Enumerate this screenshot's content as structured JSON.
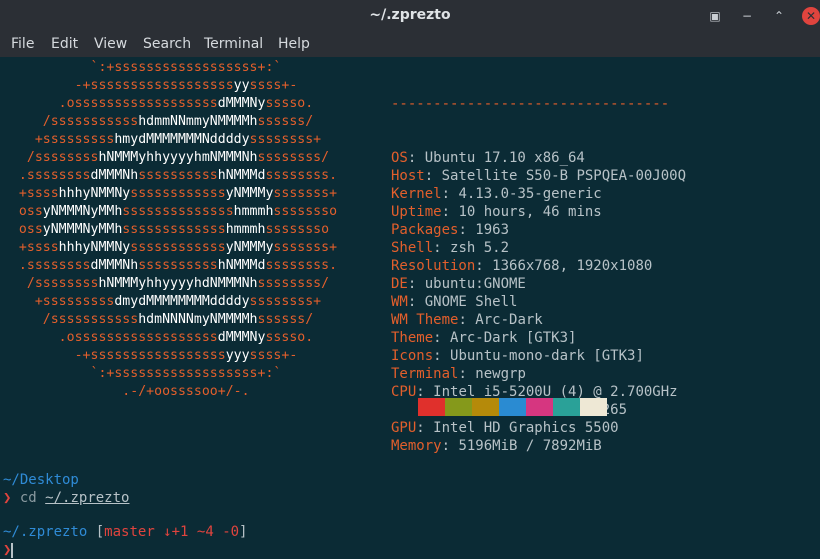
{
  "window": {
    "title": "~/.zprezto",
    "buttons": {
      "terminal_icon": "▣",
      "minimize": "−",
      "restore": "⌃",
      "close": "✕"
    }
  },
  "menu": [
    "File",
    "Edit",
    "View",
    "Search",
    "Terminal",
    "Help"
  ],
  "logo_lines": [
    "           `:+ssssssssssssssssss+:`",
    "         -+ssssssssssssssssssyyssss+-",
    "       .ossssssssssssssssssdMMMNysssso.",
    "     /ssssssssssshdmmNNmmyNMMMMhssssss/",
    "    +ssssssssshmydMMMMMMMNddddyssssssss+",
    "   /sssssssshNMMMyhhyyyyhmNMMMNhssssssss/",
    "  .ssssssssdMMMNhsssssssssshNMMMdssssssss.",
    "  +sssshhhyNMMNyssssssssssssyNMMMysssssss+",
    "  ossyNMMMNyMMhsssssssssssssshmmmhssssssso",
    "  ossyNMMMNyMMhssssssssssssshmmmhssssssso",
    "  +sssshhhyNMMNyssssssssssssyNMMMysssssss+",
    "  .ssssssssdMMMNhsssssssssshNMMMdssssssss.",
    "   /sssssssshNMMMyhhyyyyhdNMMMNhssssssss/",
    "    +sssssssssdmydMMMMMMMMddddyssssssss+",
    "     /ssssssssssshdmNNNNmyNMMMMhssssss/",
    "       .ossssssssssssssssssdMMMNysssso.",
    "         -+sssssssssssssssssyyyssss+-",
    "           `:+ssssssssssssssssss+:`",
    "               .-/+oossssoo+/-."
  ],
  "info": {
    "separator": "---------------------------------",
    "rows": [
      {
        "key": "OS",
        "value": "Ubuntu 17.10 x86_64"
      },
      {
        "key": "Host",
        "value": "Satellite S50-B PSPQEA-00J00Q"
      },
      {
        "key": "Kernel",
        "value": "4.13.0-35-generic"
      },
      {
        "key": "Uptime",
        "value": "10 hours, 46 mins"
      },
      {
        "key": "Packages",
        "value": "1963"
      },
      {
        "key": "Shell",
        "value": "zsh 5.2"
      },
      {
        "key": "Resolution",
        "value": "1366x768, 1920x1080"
      },
      {
        "key": "DE",
        "value": "ubuntu:GNOME"
      },
      {
        "key": "WM",
        "value": "GNOME Shell"
      },
      {
        "key": "WM Theme",
        "value": "Arc-Dark"
      },
      {
        "key": "Theme",
        "value": "Arc-Dark [GTK3]"
      },
      {
        "key": "Icons",
        "value": "Ubuntu-mono-dark [GTK3]"
      },
      {
        "key": "Terminal",
        "value": "newgrp"
      },
      {
        "key": "CPU",
        "value": "Intel i5-5200U (4) @ 2.700GHz"
      },
      {
        "key": "GPU",
        "value": "AMD Radeon R7 M260/M265"
      },
      {
        "key": "GPU",
        "value": "Intel HD Graphics 5500"
      },
      {
        "key": "Memory",
        "value": "5196MiB / 7892MiB"
      }
    ],
    "palette": [
      "#0b2b35",
      "#e0302c",
      "#85991b",
      "#b58a0a",
      "#2a8bd2",
      "#d63680",
      "#2aa198",
      "#eee8d5"
    ]
  },
  "prompt1": {
    "path": "~/Desktop",
    "symbol": "❯",
    "cmd": "cd",
    "arg": "~/.zprezto"
  },
  "prompt2": {
    "path": "~/.zprezto",
    "open": "[",
    "branch": "master",
    "status": "↓+1 ~4 -0",
    "close": "]",
    "symbol": "❯"
  }
}
